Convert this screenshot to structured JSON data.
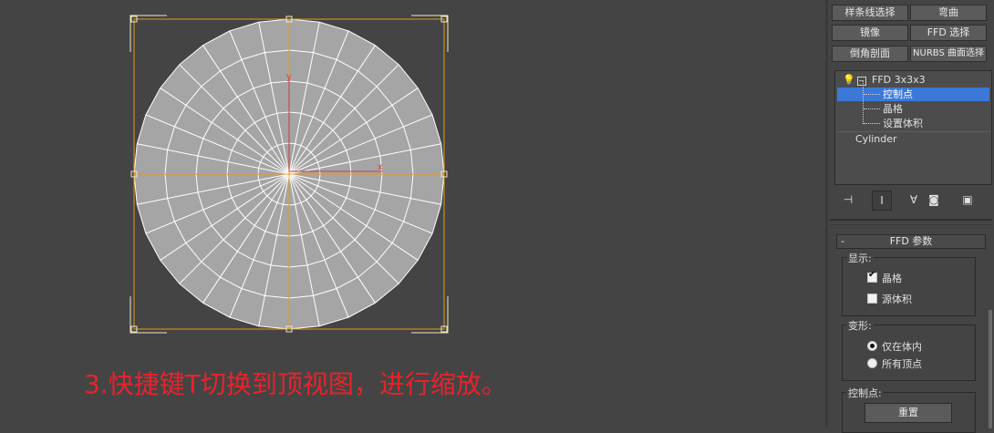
{
  "viewport": {
    "axis_y_label": "y",
    "axis_x_label": "x",
    "caption": "3.快捷键T切换到顶视图，进行缩放。"
  },
  "modifier_buttons": [
    {
      "name": "spline-select",
      "label": "样条线选择"
    },
    {
      "name": "bend",
      "label": "弯曲"
    },
    {
      "name": "mirror",
      "label": "镜像"
    },
    {
      "name": "ffd-select",
      "label": "FFD 选择"
    },
    {
      "name": "bevel-profile",
      "label": "倒角剖面"
    },
    {
      "name": "nurbs-surface-select",
      "label": "NURBS 曲面选择"
    }
  ],
  "modifier_stack": {
    "modifier": "FFD 3x3x3",
    "sub_items": [
      "控制点",
      "晶格",
      "设置体积"
    ],
    "base_object": "Cylinder"
  },
  "rollout": {
    "title": "FFD 参数",
    "collapse_symbol": "-",
    "display_group": "显示:",
    "lattice_label": "晶格",
    "lattice_checked": true,
    "source_volume_label": "源体积",
    "source_volume_checked": false,
    "deform_group": "变形:",
    "only_in_volume_label": "仅在体内",
    "all_vertices_label": "所有顶点",
    "deform_selected": "仅在体内",
    "control_points_group": "控制点:",
    "reset_label": "重置"
  },
  "colors": {
    "background": "#444444",
    "mesh_fill": "#a5a5a5",
    "lattice": "#e59a1a",
    "selection": "#f0e8c0",
    "caption": "#e8232a",
    "highlight": "#3b78d8"
  }
}
